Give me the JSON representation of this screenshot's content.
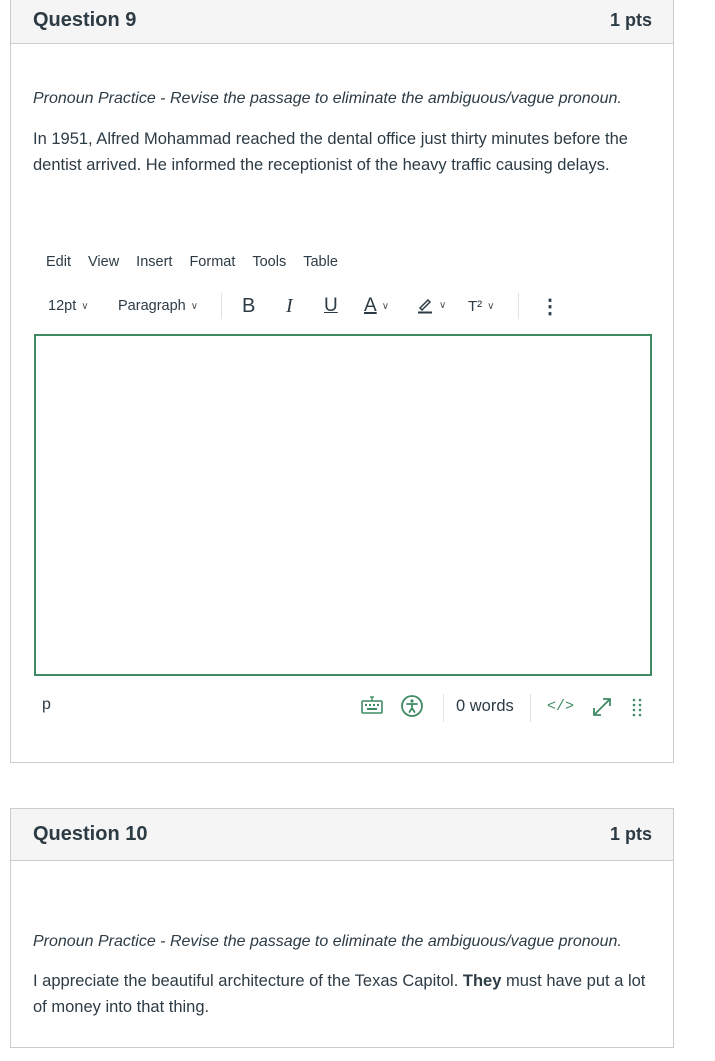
{
  "question9": {
    "title": "Question 9",
    "points": "1 pts",
    "instruction": "Pronoun Practice - Revise the passage to eliminate the ambiguous/vague pronoun.",
    "passage": "In 1951, Alfred Mohammad reached the dental office just thirty minutes before the dentist arrived. He informed the receptionist of the heavy traffic causing delays."
  },
  "editor": {
    "menu": [
      "Edit",
      "View",
      "Insert",
      "Format",
      "Tools",
      "Table"
    ],
    "font_size": "12pt",
    "block_format": "Paragraph",
    "bold_label": "B",
    "italic_label": "I",
    "underline_label": "U",
    "text_color_label": "A",
    "superscript_label": "T²",
    "more_label": "⋮",
    "status_path": "p",
    "word_count": "0 words",
    "html_label": "</>",
    "icons": {
      "keyboard": "keyboard-icon",
      "accessibility": "accessibility-icon",
      "expand": "expand-icon",
      "resize": "resize-handle-icon",
      "highlight": "highlight-pen-icon"
    },
    "accent_color": "#3f8a63"
  },
  "question10": {
    "title": "Question 10",
    "points": "1 pts",
    "instruction": "Pronoun Practice - Revise the passage to eliminate the ambiguous/vague pronoun.",
    "passage_before": "I appreciate the beautiful architecture of the Texas Capitol. ",
    "passage_bold": "They",
    "passage_after": " must have put a lot of money into that thing."
  }
}
